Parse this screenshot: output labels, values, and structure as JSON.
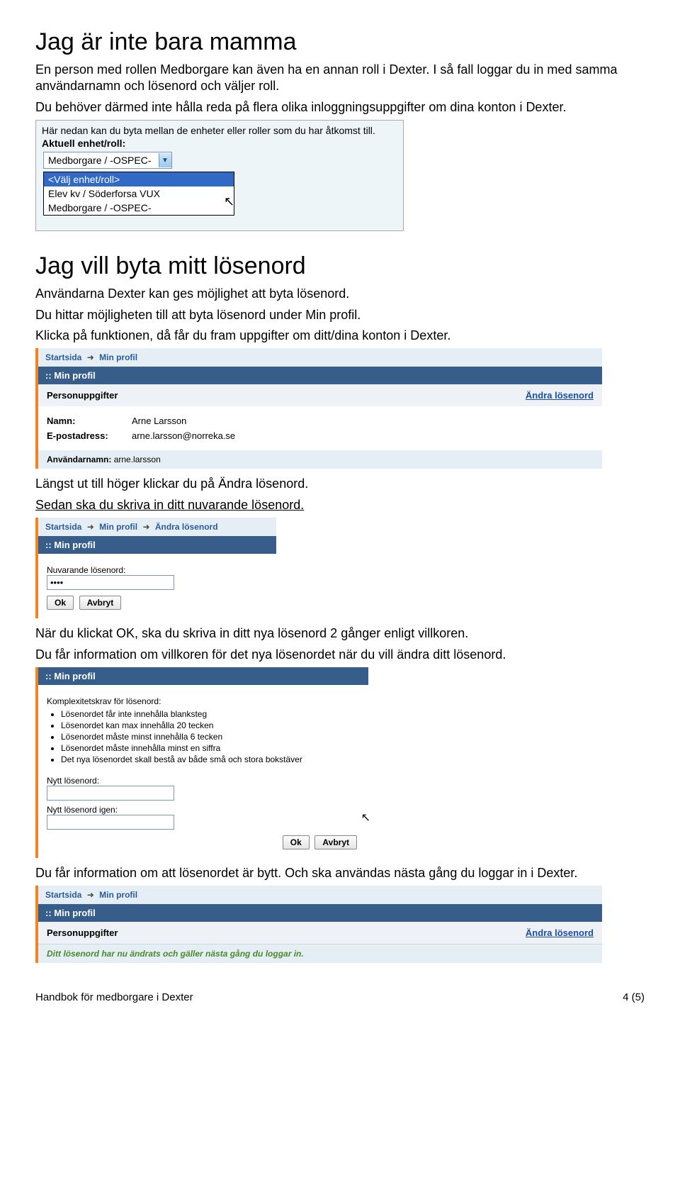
{
  "heading1": "Jag är inte bara mamma",
  "intro1a": "En person med rollen Medborgare kan även ha en annan roll i Dexter. I så fall loggar du in med samma användarnamn och lösenord och väljer roll.",
  "intro1b": "Du behöver därmed inte hålla reda på flera olika inloggningsuppgifter om dina konton i Dexter.",
  "shot1": {
    "instr": "Här nedan kan du byta mellan de enheter eller roller som du har åtkomst till.",
    "label": "Aktuell enhet/roll:",
    "selected": "Medborgare / -OSPEC-",
    "options": [
      "<Välj enhet/roll>",
      "Elev kv / Söderforsa VUX",
      "Medborgare / -OSPEC-"
    ]
  },
  "heading2": "Jag vill byta mitt lösenord",
  "intro2a": "Användarna Dexter kan ges möjlighet att byta lösenord.",
  "intro2b": "Du hittar möjligheten till att byta lösenord under Min profil.",
  "intro2c": "Klicka på funktionen, då får du fram uppgifter om ditt/dina konton i Dexter.",
  "portal1": {
    "bc1": "Startsida",
    "bc2": "Min profil",
    "bar": ":: Min profil",
    "panelTitle": "Personuppgifter",
    "link": "Ändra lösenord",
    "nameLabel": "Namn:",
    "nameVal": "Arne Larsson",
    "emailLabel": "E-postadress:",
    "emailVal": "arne.larsson@norreka.se",
    "userLabel": "Användarnamn:",
    "userVal": "arne.larsson"
  },
  "afterP1": "Längst ut till höger klickar du på Ändra lösenord.",
  "beforeP2": "Sedan ska du skriva in ditt nuvarande lösenord.",
  "portal2": {
    "bc1": "Startsida",
    "bc2": "Min profil",
    "bc3": "Ändra lösenord",
    "bar": ":: Min profil",
    "label": "Nuvarande lösenord:",
    "value": "••••",
    "ok": "Ok",
    "cancel": "Avbryt"
  },
  "afterP2a": "När du klickat OK, ska du skriva in ditt nya lösenord 2 gånger enligt villkoren.",
  "afterP2b": "Du får information om villkoren för det nya lösenordet när du vill ändra ditt lösenord.",
  "portal3": {
    "bar": ":: Min profil",
    "kTitle": "Komplexitetskrav för lösenord:",
    "rules": [
      "Lösenordet får inte innehålla blanksteg",
      "Lösenordet kan max innehålla 20 tecken",
      "Lösenordet måste minst innehålla 6 tecken",
      "Lösenordet måste innehålla minst en siffra",
      "Det nya lösenordet skall bestå av både små och stora bokstäver"
    ],
    "new1": "Nytt lösenord:",
    "new2": "Nytt lösenord igen:",
    "ok": "Ok",
    "cancel": "Avbryt"
  },
  "afterP3": "Du får information om att lösenordet är bytt. Och ska användas nästa gång du loggar in i Dexter.",
  "portal4": {
    "bc1": "Startsida",
    "bc2": "Min profil",
    "bar": ":: Min profil",
    "panelTitle": "Personuppgifter",
    "link": "Ändra lösenord",
    "msg": "Ditt lösenord har nu ändrats och gäller nästa gång du loggar in."
  },
  "footerLeft": "Handbok för medborgare i Dexter",
  "footerRight": "4 (5)"
}
